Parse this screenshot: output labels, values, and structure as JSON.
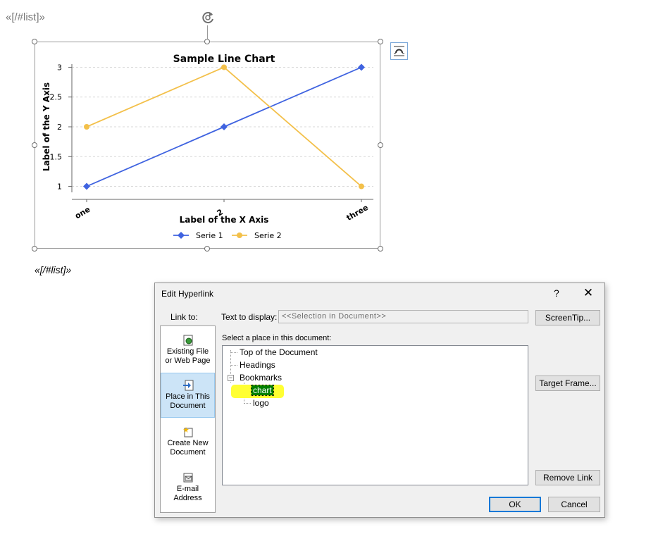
{
  "document": {
    "top_tag": "«[/#list]»",
    "bottom_tag": "«[/#list]»"
  },
  "chart_data": {
    "type": "line",
    "title": "Sample Line Chart",
    "xlabel": "Label of the X Axis",
    "ylabel": "Label of the Y Axis",
    "categories": [
      "one",
      "2",
      "three"
    ],
    "ylim": [
      0.9,
      3.1
    ],
    "yticks": [
      "1",
      "1.5",
      "2",
      "2.5",
      "3"
    ],
    "grid": "horizontal-dashed",
    "legend_position": "bottom",
    "series": [
      {
        "name": "Serie 1",
        "values": [
          1,
          2,
          3
        ],
        "color": "#3f63e0",
        "marker": "diamond"
      },
      {
        "name": "Serie 2",
        "values": [
          2,
          3,
          1
        ],
        "color": "#f3c04a",
        "marker": "circle"
      }
    ]
  },
  "dialog": {
    "title": "Edit Hyperlink",
    "help": "?",
    "close": "✕",
    "link_to_label": "Link to:",
    "link_options": [
      {
        "line1": "Existing File",
        "line2": "or Web Page",
        "icon": "web-page-icon"
      },
      {
        "line1": "Place in This",
        "line2": "Document",
        "icon": "place-in-document-icon",
        "selected": true
      },
      {
        "line1": "Create New",
        "line2": "Document",
        "icon": "new-document-icon"
      },
      {
        "line1": "E-mail",
        "line2": "Address",
        "icon": "email-icon"
      }
    ],
    "text_display_label": "Text to display:",
    "text_display_value": "<<Selection in Document>>",
    "place_label": "Select a place in this document:",
    "tree": {
      "top": "Top of the Document",
      "headings": "Headings",
      "bookmarks": "Bookmarks",
      "expander": "−",
      "bookmark_items": [
        "chart",
        "logo"
      ]
    },
    "buttons": {
      "screentip": "ScreenTip...",
      "target_frame": "Target Frame...",
      "remove_link": "Remove Link",
      "ok": "OK",
      "cancel": "Cancel"
    },
    "colors": {
      "selection": "#008000",
      "highlight": "#ffff33",
      "selected_option": "#cce4f7"
    }
  }
}
